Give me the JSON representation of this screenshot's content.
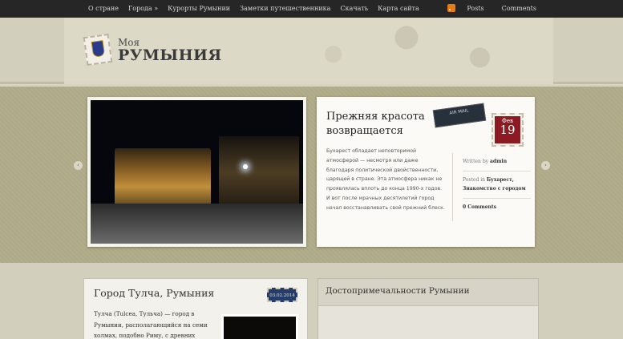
{
  "nav": {
    "items": [
      "О стране",
      "Города »",
      "Курорты Румынии",
      "Заметки путешественника",
      "Скачать",
      "Карта сайта"
    ],
    "feeds": {
      "posts": "Posts",
      "comments": "Comments"
    }
  },
  "header": {
    "title_small": "Моя",
    "title_big": "РУМЫНИЯ"
  },
  "slider": {
    "prev": "‹",
    "next": "›",
    "post": {
      "title": "Прежняя красота возвращается",
      "air_mail": "AIR MAIL",
      "date_month": "Фев",
      "date_day": "19",
      "excerpt": "Бухарест обладает неповторимой атмосферой — несмотря или даже благодаря политической двойственности, царящей в стране. Эта атмосфера никак не проявлялась вплоть до конца 1990-х годов. И вот после мрачных десятилетий город начал восстанавливать свой прежний блеск.",
      "written_by_label": "Written by",
      "author": "admin",
      "posted_in_label": "Posted in",
      "category_1": "Бухарест",
      "category_2": "Знакомство с городом",
      "comments": "0 Comments"
    }
  },
  "lower": {
    "post": {
      "title": "Город Тулча, Румыния",
      "date": "03.02.2014",
      "text": "Тулча (Tulcea, Тульча) — город в Румынии, располагающийся на семи холмах, подобно Риму, с древних"
    },
    "widget": {
      "title": "Достопримечальности Румынии"
    }
  },
  "colors": {
    "topbar": "#262626",
    "date_stamp": "#8b1a22",
    "accent_blue": "#253d68"
  }
}
